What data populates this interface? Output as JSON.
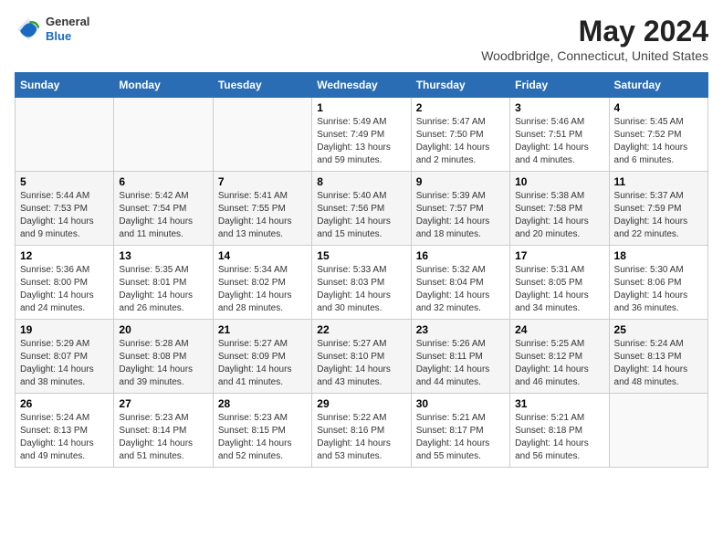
{
  "logo": {
    "general": "General",
    "blue": "Blue"
  },
  "title": "May 2024",
  "subtitle": "Woodbridge, Connecticut, United States",
  "days_of_week": [
    "Sunday",
    "Monday",
    "Tuesday",
    "Wednesday",
    "Thursday",
    "Friday",
    "Saturday"
  ],
  "weeks": [
    [
      {
        "day": "",
        "info": ""
      },
      {
        "day": "",
        "info": ""
      },
      {
        "day": "",
        "info": ""
      },
      {
        "day": "1",
        "info": "Sunrise: 5:49 AM\nSunset: 7:49 PM\nDaylight: 13 hours\nand 59 minutes."
      },
      {
        "day": "2",
        "info": "Sunrise: 5:47 AM\nSunset: 7:50 PM\nDaylight: 14 hours\nand 2 minutes."
      },
      {
        "day": "3",
        "info": "Sunrise: 5:46 AM\nSunset: 7:51 PM\nDaylight: 14 hours\nand 4 minutes."
      },
      {
        "day": "4",
        "info": "Sunrise: 5:45 AM\nSunset: 7:52 PM\nDaylight: 14 hours\nand 6 minutes."
      }
    ],
    [
      {
        "day": "5",
        "info": "Sunrise: 5:44 AM\nSunset: 7:53 PM\nDaylight: 14 hours\nand 9 minutes."
      },
      {
        "day": "6",
        "info": "Sunrise: 5:42 AM\nSunset: 7:54 PM\nDaylight: 14 hours\nand 11 minutes."
      },
      {
        "day": "7",
        "info": "Sunrise: 5:41 AM\nSunset: 7:55 PM\nDaylight: 14 hours\nand 13 minutes."
      },
      {
        "day": "8",
        "info": "Sunrise: 5:40 AM\nSunset: 7:56 PM\nDaylight: 14 hours\nand 15 minutes."
      },
      {
        "day": "9",
        "info": "Sunrise: 5:39 AM\nSunset: 7:57 PM\nDaylight: 14 hours\nand 18 minutes."
      },
      {
        "day": "10",
        "info": "Sunrise: 5:38 AM\nSunset: 7:58 PM\nDaylight: 14 hours\nand 20 minutes."
      },
      {
        "day": "11",
        "info": "Sunrise: 5:37 AM\nSunset: 7:59 PM\nDaylight: 14 hours\nand 22 minutes."
      }
    ],
    [
      {
        "day": "12",
        "info": "Sunrise: 5:36 AM\nSunset: 8:00 PM\nDaylight: 14 hours\nand 24 minutes."
      },
      {
        "day": "13",
        "info": "Sunrise: 5:35 AM\nSunset: 8:01 PM\nDaylight: 14 hours\nand 26 minutes."
      },
      {
        "day": "14",
        "info": "Sunrise: 5:34 AM\nSunset: 8:02 PM\nDaylight: 14 hours\nand 28 minutes."
      },
      {
        "day": "15",
        "info": "Sunrise: 5:33 AM\nSunset: 8:03 PM\nDaylight: 14 hours\nand 30 minutes."
      },
      {
        "day": "16",
        "info": "Sunrise: 5:32 AM\nSunset: 8:04 PM\nDaylight: 14 hours\nand 32 minutes."
      },
      {
        "day": "17",
        "info": "Sunrise: 5:31 AM\nSunset: 8:05 PM\nDaylight: 14 hours\nand 34 minutes."
      },
      {
        "day": "18",
        "info": "Sunrise: 5:30 AM\nSunset: 8:06 PM\nDaylight: 14 hours\nand 36 minutes."
      }
    ],
    [
      {
        "day": "19",
        "info": "Sunrise: 5:29 AM\nSunset: 8:07 PM\nDaylight: 14 hours\nand 38 minutes."
      },
      {
        "day": "20",
        "info": "Sunrise: 5:28 AM\nSunset: 8:08 PM\nDaylight: 14 hours\nand 39 minutes."
      },
      {
        "day": "21",
        "info": "Sunrise: 5:27 AM\nSunset: 8:09 PM\nDaylight: 14 hours\nand 41 minutes."
      },
      {
        "day": "22",
        "info": "Sunrise: 5:27 AM\nSunset: 8:10 PM\nDaylight: 14 hours\nand 43 minutes."
      },
      {
        "day": "23",
        "info": "Sunrise: 5:26 AM\nSunset: 8:11 PM\nDaylight: 14 hours\nand 44 minutes."
      },
      {
        "day": "24",
        "info": "Sunrise: 5:25 AM\nSunset: 8:12 PM\nDaylight: 14 hours\nand 46 minutes."
      },
      {
        "day": "25",
        "info": "Sunrise: 5:24 AM\nSunset: 8:13 PM\nDaylight: 14 hours\nand 48 minutes."
      }
    ],
    [
      {
        "day": "26",
        "info": "Sunrise: 5:24 AM\nSunset: 8:13 PM\nDaylight: 14 hours\nand 49 minutes."
      },
      {
        "day": "27",
        "info": "Sunrise: 5:23 AM\nSunset: 8:14 PM\nDaylight: 14 hours\nand 51 minutes."
      },
      {
        "day": "28",
        "info": "Sunrise: 5:23 AM\nSunset: 8:15 PM\nDaylight: 14 hours\nand 52 minutes."
      },
      {
        "day": "29",
        "info": "Sunrise: 5:22 AM\nSunset: 8:16 PM\nDaylight: 14 hours\nand 53 minutes."
      },
      {
        "day": "30",
        "info": "Sunrise: 5:21 AM\nSunset: 8:17 PM\nDaylight: 14 hours\nand 55 minutes."
      },
      {
        "day": "31",
        "info": "Sunrise: 5:21 AM\nSunset: 8:18 PM\nDaylight: 14 hours\nand 56 minutes."
      },
      {
        "day": "",
        "info": ""
      }
    ]
  ]
}
